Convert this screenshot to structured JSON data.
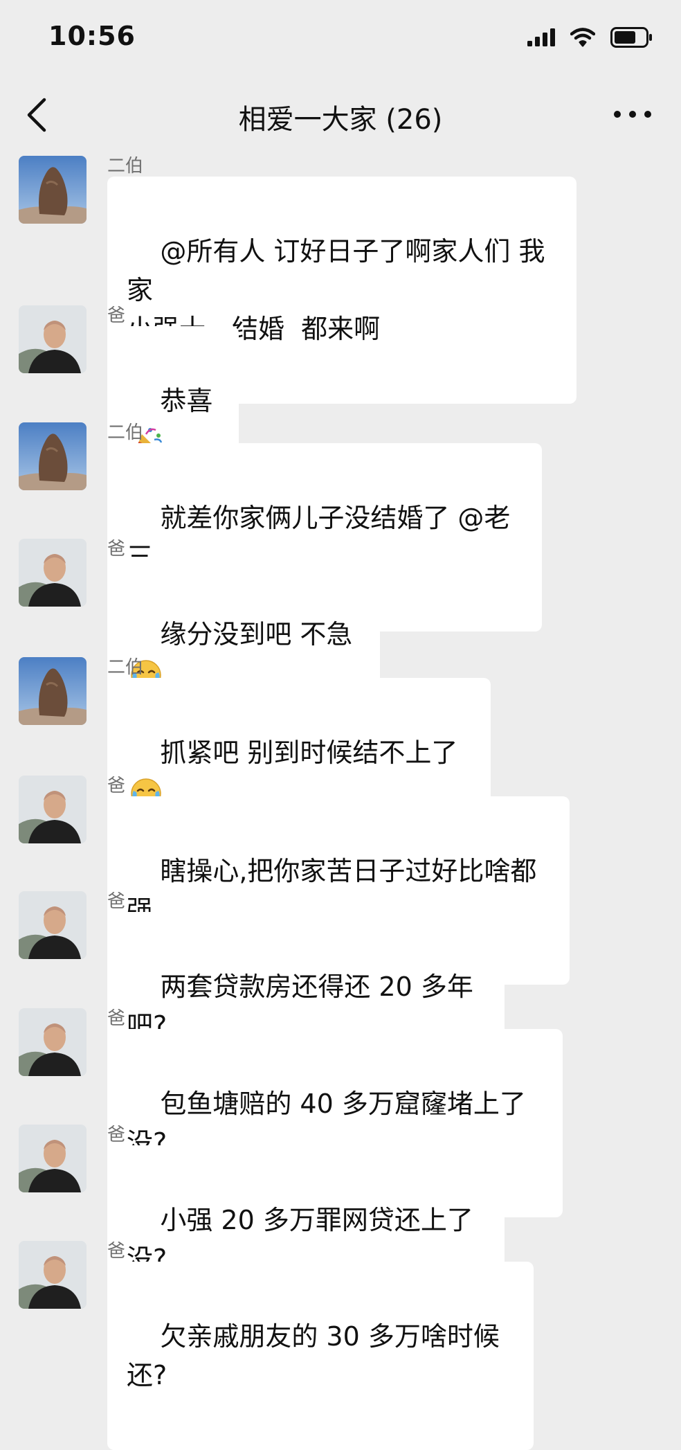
{
  "status_bar": {
    "time": "10:56"
  },
  "header": {
    "title": "相爱一大家 (26)"
  },
  "messages": [
    {
      "sender": "二伯",
      "text": "@所有人 订好日子了啊家人们 我家\n小强十一结婚  都来啊"
    },
    {
      "sender": "爸",
      "text": "恭喜"
    },
    {
      "sender": "二伯",
      "text": "就差你家俩儿子没结婚了 @老三"
    },
    {
      "sender": "爸",
      "text": "缘分没到吧 不急"
    },
    {
      "sender": "二伯",
      "text": "抓紧吧 别到时候结不上了"
    },
    {
      "sender": "爸",
      "text": "瞎操心,把你家苦日子过好比啥都强"
    },
    {
      "sender": "爸",
      "text": "两套贷款房还得还 20 多年吧?"
    },
    {
      "sender": "爸",
      "text": "包鱼塘赔的 40 多万窟窿堵上了没?"
    },
    {
      "sender": "爸",
      "text": "小强 20 多万罪网贷还上了没?"
    },
    {
      "sender": "爸",
      "text": "欠亲戚朋友的 30 多万啥时候还?"
    }
  ],
  "icons": {
    "signal": "signal-icon",
    "wifi": "wifi-icon",
    "battery": "battery-icon",
    "back": "back-chevron-icon",
    "more": "more-icon",
    "party": "party-popper-icon",
    "cry_laugh": "rolling-laughing-icon"
  },
  "colors": {
    "background": "#ededed",
    "bubble": "#ffffff",
    "sender_text": "#707070"
  }
}
